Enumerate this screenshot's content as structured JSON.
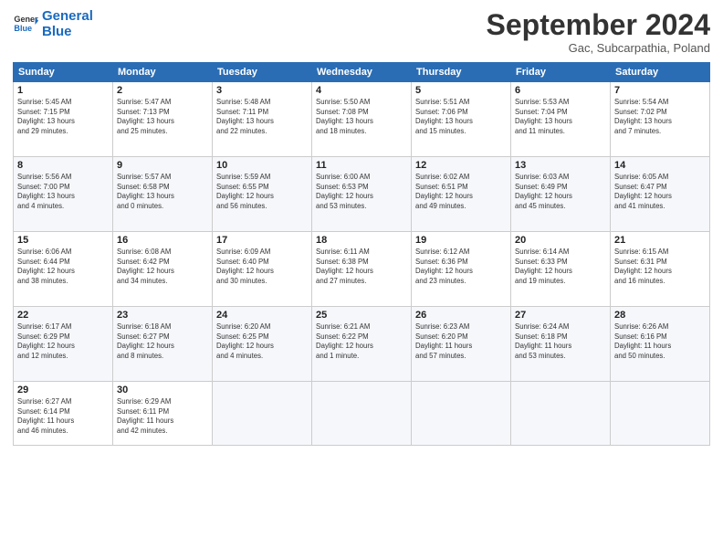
{
  "logo": {
    "line1": "General",
    "line2": "Blue"
  },
  "title": "September 2024",
  "subtitle": "Gac, Subcarpathia, Poland",
  "weekdays": [
    "Sunday",
    "Monday",
    "Tuesday",
    "Wednesday",
    "Thursday",
    "Friday",
    "Saturday"
  ],
  "weeks": [
    [
      {
        "day": "1",
        "info": "Sunrise: 5:45 AM\nSunset: 7:15 PM\nDaylight: 13 hours\nand 29 minutes."
      },
      {
        "day": "2",
        "info": "Sunrise: 5:47 AM\nSunset: 7:13 PM\nDaylight: 13 hours\nand 25 minutes."
      },
      {
        "day": "3",
        "info": "Sunrise: 5:48 AM\nSunset: 7:11 PM\nDaylight: 13 hours\nand 22 minutes."
      },
      {
        "day": "4",
        "info": "Sunrise: 5:50 AM\nSunset: 7:08 PM\nDaylight: 13 hours\nand 18 minutes."
      },
      {
        "day": "5",
        "info": "Sunrise: 5:51 AM\nSunset: 7:06 PM\nDaylight: 13 hours\nand 15 minutes."
      },
      {
        "day": "6",
        "info": "Sunrise: 5:53 AM\nSunset: 7:04 PM\nDaylight: 13 hours\nand 11 minutes."
      },
      {
        "day": "7",
        "info": "Sunrise: 5:54 AM\nSunset: 7:02 PM\nDaylight: 13 hours\nand 7 minutes."
      }
    ],
    [
      {
        "day": "8",
        "info": "Sunrise: 5:56 AM\nSunset: 7:00 PM\nDaylight: 13 hours\nand 4 minutes."
      },
      {
        "day": "9",
        "info": "Sunrise: 5:57 AM\nSunset: 6:58 PM\nDaylight: 13 hours\nand 0 minutes."
      },
      {
        "day": "10",
        "info": "Sunrise: 5:59 AM\nSunset: 6:55 PM\nDaylight: 12 hours\nand 56 minutes."
      },
      {
        "day": "11",
        "info": "Sunrise: 6:00 AM\nSunset: 6:53 PM\nDaylight: 12 hours\nand 53 minutes."
      },
      {
        "day": "12",
        "info": "Sunrise: 6:02 AM\nSunset: 6:51 PM\nDaylight: 12 hours\nand 49 minutes."
      },
      {
        "day": "13",
        "info": "Sunrise: 6:03 AM\nSunset: 6:49 PM\nDaylight: 12 hours\nand 45 minutes."
      },
      {
        "day": "14",
        "info": "Sunrise: 6:05 AM\nSunset: 6:47 PM\nDaylight: 12 hours\nand 41 minutes."
      }
    ],
    [
      {
        "day": "15",
        "info": "Sunrise: 6:06 AM\nSunset: 6:44 PM\nDaylight: 12 hours\nand 38 minutes."
      },
      {
        "day": "16",
        "info": "Sunrise: 6:08 AM\nSunset: 6:42 PM\nDaylight: 12 hours\nand 34 minutes."
      },
      {
        "day": "17",
        "info": "Sunrise: 6:09 AM\nSunset: 6:40 PM\nDaylight: 12 hours\nand 30 minutes."
      },
      {
        "day": "18",
        "info": "Sunrise: 6:11 AM\nSunset: 6:38 PM\nDaylight: 12 hours\nand 27 minutes."
      },
      {
        "day": "19",
        "info": "Sunrise: 6:12 AM\nSunset: 6:36 PM\nDaylight: 12 hours\nand 23 minutes."
      },
      {
        "day": "20",
        "info": "Sunrise: 6:14 AM\nSunset: 6:33 PM\nDaylight: 12 hours\nand 19 minutes."
      },
      {
        "day": "21",
        "info": "Sunrise: 6:15 AM\nSunset: 6:31 PM\nDaylight: 12 hours\nand 16 minutes."
      }
    ],
    [
      {
        "day": "22",
        "info": "Sunrise: 6:17 AM\nSunset: 6:29 PM\nDaylight: 12 hours\nand 12 minutes."
      },
      {
        "day": "23",
        "info": "Sunrise: 6:18 AM\nSunset: 6:27 PM\nDaylight: 12 hours\nand 8 minutes."
      },
      {
        "day": "24",
        "info": "Sunrise: 6:20 AM\nSunset: 6:25 PM\nDaylight: 12 hours\nand 4 minutes."
      },
      {
        "day": "25",
        "info": "Sunrise: 6:21 AM\nSunset: 6:22 PM\nDaylight: 12 hours\nand 1 minute."
      },
      {
        "day": "26",
        "info": "Sunrise: 6:23 AM\nSunset: 6:20 PM\nDaylight: 11 hours\nand 57 minutes."
      },
      {
        "day": "27",
        "info": "Sunrise: 6:24 AM\nSunset: 6:18 PM\nDaylight: 11 hours\nand 53 minutes."
      },
      {
        "day": "28",
        "info": "Sunrise: 6:26 AM\nSunset: 6:16 PM\nDaylight: 11 hours\nand 50 minutes."
      }
    ],
    [
      {
        "day": "29",
        "info": "Sunrise: 6:27 AM\nSunset: 6:14 PM\nDaylight: 11 hours\nand 46 minutes."
      },
      {
        "day": "30",
        "info": "Sunrise: 6:29 AM\nSunset: 6:11 PM\nDaylight: 11 hours\nand 42 minutes."
      },
      {
        "day": "",
        "info": ""
      },
      {
        "day": "",
        "info": ""
      },
      {
        "day": "",
        "info": ""
      },
      {
        "day": "",
        "info": ""
      },
      {
        "day": "",
        "info": ""
      }
    ]
  ]
}
